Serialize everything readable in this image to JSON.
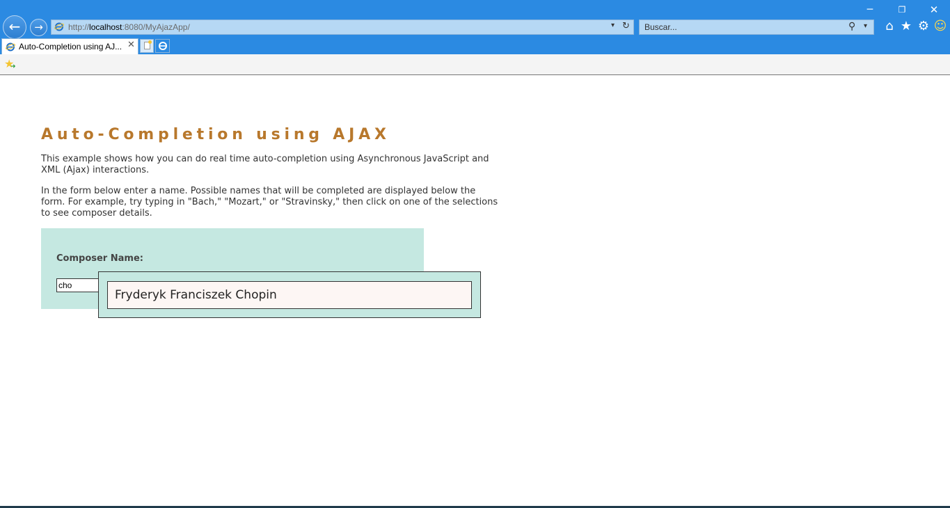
{
  "browser": {
    "window_controls": {
      "minimize": "─",
      "restore": "❐",
      "close": "✕"
    },
    "nav": {
      "back_glyph": "←",
      "forward_glyph": "→"
    },
    "address": {
      "url_prefix": "http://",
      "url_host": "localhost",
      "url_rest": ":8080/MyAjazApp/"
    },
    "search": {
      "value": "Buscar..."
    },
    "toolbar_icons": [
      "home-icon",
      "star-icon",
      "gear-icon",
      "smiley-icon"
    ],
    "tab": {
      "title": "Auto-Completion using AJ..."
    },
    "colors": {
      "chrome": "#2b8ae2",
      "address_bg": "#b6d8f4"
    }
  },
  "page": {
    "title": "Auto-Completion using AJAX",
    "intro": "This example shows how you can do real time auto-completion using Asynchronous JavaScript and XML (Ajax) interactions.",
    "instructions": "In the form below enter a name. Possible names that will be completed are displayed below the form. For example, try typing in \"Bach,\" \"Mozart,\" or \"Stravinsky,\" then click on one of the selections to see composer details.",
    "form": {
      "label": "Composer Name:",
      "input_value": "cho"
    },
    "autocomplete": {
      "suggestions": [
        "Fryderyk Franciszek Chopin"
      ]
    },
    "colors": {
      "title": "#b8782c",
      "panel": "#c5e8e1",
      "suggestion_bg": "#fdf6f4"
    }
  }
}
